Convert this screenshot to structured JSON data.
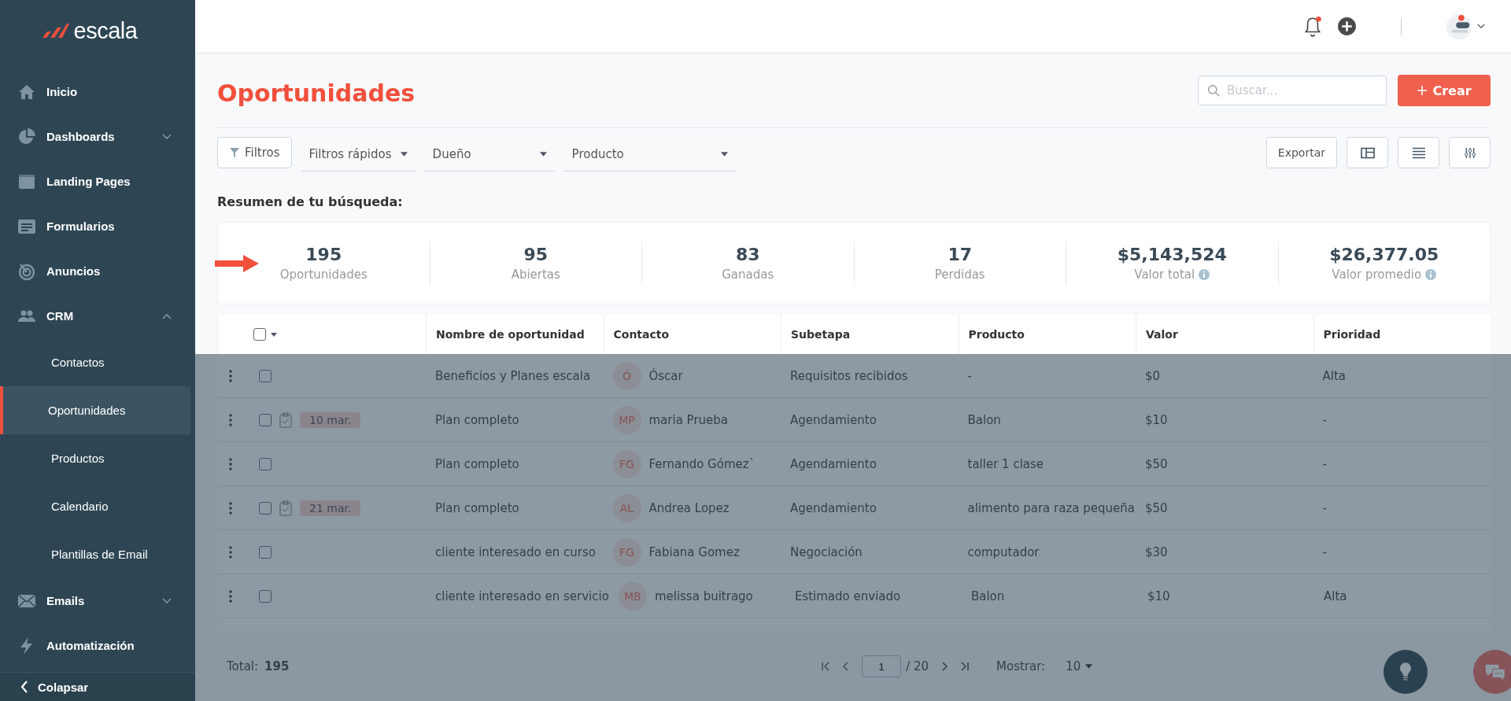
{
  "brand": {
    "name": "escala"
  },
  "sidebar": {
    "items": [
      {
        "kind": "section",
        "label": "Inicio",
        "selected": false
      },
      {
        "kind": "section",
        "label": "Dashboards",
        "selected": false,
        "expanded": false
      },
      {
        "kind": "section",
        "label": "Landing Pages",
        "selected": false
      },
      {
        "kind": "section",
        "label": "Formularios",
        "selected": false
      },
      {
        "kind": "section",
        "label": "Anuncios",
        "selected": false
      },
      {
        "kind": "section",
        "label": "CRM",
        "selected": false,
        "expanded": true
      },
      {
        "kind": "subitem",
        "label": "Contactos",
        "selected": false
      },
      {
        "kind": "subitem",
        "label": "Oportunidades",
        "selected": true
      },
      {
        "kind": "subitem",
        "label": "Productos",
        "selected": false
      },
      {
        "kind": "subitem",
        "label": "Calendario",
        "selected": false
      },
      {
        "kind": "subitem",
        "label": "Plantillas de Email",
        "selected": false
      },
      {
        "kind": "section",
        "label": "Emails",
        "selected": false,
        "expanded": false
      },
      {
        "kind": "section",
        "label": "Automatización",
        "selected": false
      }
    ],
    "collapse_label": "Colapsar"
  },
  "header": {
    "notifications_unread": true
  },
  "page": {
    "title": "Oportunidades",
    "search_placeholder": "Buscar...",
    "create_label": "Crear"
  },
  "filters": {
    "button": "Filtros",
    "dropdowns": [
      "Filtros rápidos",
      "Dueño",
      "Producto"
    ],
    "export_label": "Exportar"
  },
  "summary": {
    "title": "Resumen de tu búsqueda:",
    "stats": [
      {
        "value": "195",
        "label": "Oportunidades",
        "info": false
      },
      {
        "value": "95",
        "label": "Abiertas",
        "info": false
      },
      {
        "value": "83",
        "label": "Ganadas",
        "info": false
      },
      {
        "value": "17",
        "label": "Perdidas",
        "info": false
      },
      {
        "value": "$5,143,524",
        "label": "Valor total",
        "info": true
      },
      {
        "value": "$26,377.05",
        "label": "Valor promedio",
        "info": true
      }
    ]
  },
  "table": {
    "header_checked": false,
    "columns": [
      "Nombre de oportunidad",
      "Contacto",
      "Subetapa",
      "Producto",
      "Valor",
      "Prioridad"
    ],
    "rows": [
      {
        "checked": false,
        "name": "Beneficios y Planes escala",
        "initials": "Ó",
        "contact": "Óscar",
        "substage": "Requisitos recibidos",
        "product": "-",
        "value": "$0",
        "priority": "Alta"
      },
      {
        "checked": false,
        "task_date": "10 mar.",
        "name": "Plan completo",
        "initials": "MP",
        "contact": "maria Prueba",
        "substage": "Agendamiento",
        "product": "Balon",
        "value": "$10",
        "priority": "-"
      },
      {
        "checked": false,
        "name": "Plan completo",
        "initials": "FG",
        "contact": "Fernando Gómez`",
        "substage": "Agendamiento",
        "product": "taller 1 clase",
        "value": "$50",
        "priority": "-"
      },
      {
        "checked": false,
        "task_date": "21 mar.",
        "name": "Plan completo",
        "initials": "AL",
        "contact": "Andrea Lopez",
        "substage": "Agendamiento",
        "product": "alimento para raza pequeña",
        "value": "$50",
        "priority": "-"
      },
      {
        "checked": false,
        "name": "cliente interesado en curso",
        "initials": "FG",
        "contact": "Fabiana Gomez",
        "substage": "Negociación",
        "product": "computador",
        "value": "$30",
        "priority": "-"
      },
      {
        "checked": false,
        "name": "cliente interesado en servicio",
        "initials": "MB",
        "contact": "melissa buitrago",
        "substage": "Estimado enviado",
        "product": "Balon",
        "value": "$10",
        "priority": "Alta"
      }
    ]
  },
  "footer": {
    "total_label": "Total:",
    "total": "195",
    "page": "1",
    "pages": "/ 20",
    "show_label": "Mostrar:",
    "show_value": "10"
  }
}
